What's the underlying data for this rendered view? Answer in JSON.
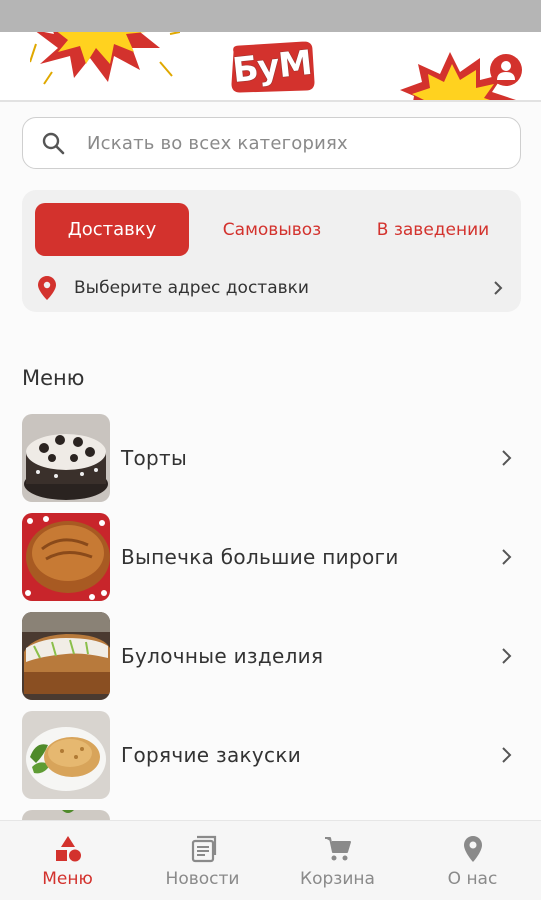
{
  "header": {
    "logo_text": "БуМ"
  },
  "search": {
    "placeholder": "Искать во всех категориях"
  },
  "delivery": {
    "tabs": [
      {
        "label": "Доставку",
        "active": true
      },
      {
        "label": "Самовывоз",
        "active": false
      },
      {
        "label": "В заведении",
        "active": false
      }
    ],
    "address_prompt": "Выберите адрес доставки"
  },
  "menu": {
    "title": "Меню",
    "items": [
      {
        "label": "Торты",
        "image": "cake-thumbnail"
      },
      {
        "label": "Выпечка большие пироги",
        "image": "pie-thumbnail"
      },
      {
        "label": "Булочные изделия",
        "image": "bun-thumbnail"
      },
      {
        "label": "Горячие закуски",
        "image": "hot-snack-thumbnail"
      },
      {
        "label": "",
        "image": "partial-thumbnail"
      }
    ]
  },
  "bottom_nav": {
    "items": [
      {
        "label": "Меню",
        "icon": "menu-shapes-icon",
        "active": true
      },
      {
        "label": "Новости",
        "icon": "news-icon",
        "active": false
      },
      {
        "label": "Корзина",
        "icon": "cart-icon",
        "active": false
      },
      {
        "label": "О нас",
        "icon": "location-pin-icon",
        "active": false
      }
    ]
  },
  "colors": {
    "accent": "#d3322d",
    "card_bg": "#f0f0f0",
    "burst_yellow": "#ffd21f"
  }
}
